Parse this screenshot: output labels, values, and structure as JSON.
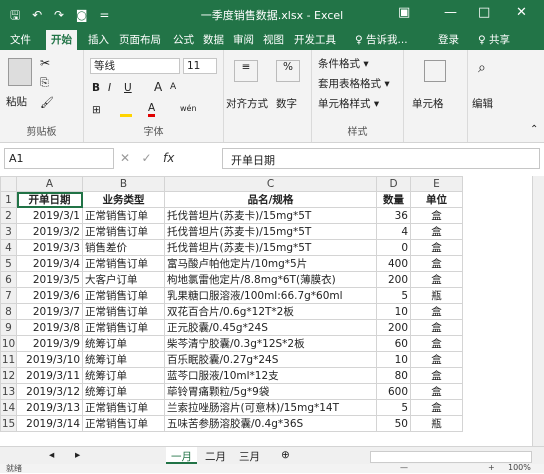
{
  "quick_access": {
    "save_icon": "save-icon",
    "undo": "↶",
    "redo": "↷",
    "camera": "◙",
    "more": "="
  },
  "window": {
    "title": "一季度销售数据.xlsx - Excel",
    "minimize": "—",
    "maximize": "□",
    "close": "✕",
    "ribbon_display": "▣"
  },
  "tabs": [
    "文件",
    "开始",
    "插入",
    "页面布局",
    "公式",
    "数据",
    "审阅",
    "视图",
    "开发工具",
    "♀ 告诉我...",
    "登录",
    "♀ 共享"
  ],
  "ribbon": {
    "paste": "粘贴",
    "clipboard": "剪贴板",
    "font_name": "等线",
    "font_size": "11",
    "font_group": "字体",
    "bold": "B",
    "italic": "I",
    "underline": "U",
    "grow": "A",
    "shrink": "A",
    "wen": "wén",
    "align": "对齐方式",
    "number": "数字",
    "percent": "%",
    "cond_format": "条件格式 ▾",
    "table_format": "套用表格格式 ▾",
    "cell_style": "单元格样式 ▾",
    "styles": "样式",
    "cells": "单元格",
    "edit": "编辑"
  },
  "formula_bar": {
    "name_box": "A1",
    "cancel": "✕",
    "enter": "✓",
    "fx": "fx",
    "content": "开单日期"
  },
  "columns": [
    "A",
    "B",
    "C",
    "D",
    "E"
  ],
  "headers": [
    "开单日期",
    "业务类型",
    "品名/规格",
    "数量",
    "单位"
  ],
  "rows": [
    [
      "2019/3/1",
      "正常销售订单",
      "托伐普坦片(苏麦卡)/15mg*5T",
      "36",
      "盒"
    ],
    [
      "2019/3/2",
      "正常销售订单",
      "托伐普坦片(苏麦卡)/15mg*5T",
      "4",
      "盒"
    ],
    [
      "2019/3/3",
      "销售差价",
      "托伐普坦片(苏麦卡)/15mg*5T",
      "0",
      "盒"
    ],
    [
      "2019/3/4",
      "正常销售订单",
      "富马酸卢帕他定片/10mg*5片",
      "400",
      "盒"
    ],
    [
      "2019/3/5",
      "大客户订单",
      "枸地氯雷他定片/8.8mg*6T(薄膜衣)",
      "200",
      "盒"
    ],
    [
      "2019/3/6",
      "正常销售订单",
      "乳果糖口服溶液/100ml:66.7g*60ml",
      "5",
      "瓶"
    ],
    [
      "2019/3/7",
      "正常销售订单",
      "双花百合片/0.6g*12T*2板",
      "10",
      "盒"
    ],
    [
      "2019/3/8",
      "正常销售订单",
      "正元胶囊/0.45g*24S",
      "200",
      "盒"
    ],
    [
      "2019/3/9",
      "统筹订单",
      "柴芩清宁胶囊/0.3g*12S*2板",
      "60",
      "盒"
    ],
    [
      "2019/3/10",
      "统筹订单",
      "百乐眠胶囊/0.27g*24S",
      "10",
      "盒"
    ],
    [
      "2019/3/11",
      "统筹订单",
      "蓝芩口服液/10ml*12支",
      "80",
      "盒"
    ],
    [
      "2019/3/12",
      "统筹订单",
      "荜铃胃痛颗粒/5g*9袋",
      "600",
      "盒"
    ],
    [
      "2019/3/13",
      "正常销售订单",
      "兰索拉唑肠溶片(可意林)/15mg*14T",
      "5",
      "盒"
    ],
    [
      "2019/3/14",
      "正常销售订单",
      "五味苦参肠溶胶囊/0.4g*36S",
      "50",
      "瓶"
    ]
  ],
  "sheets": [
    "一月",
    "二月",
    "三月"
  ],
  "add_sheet": "⊕",
  "status": {
    "ready": "就绪",
    "zoom": "100%",
    "zoom_minus": "—",
    "zoom_plus": "+"
  },
  "colors": {
    "accent": "#227447"
  }
}
